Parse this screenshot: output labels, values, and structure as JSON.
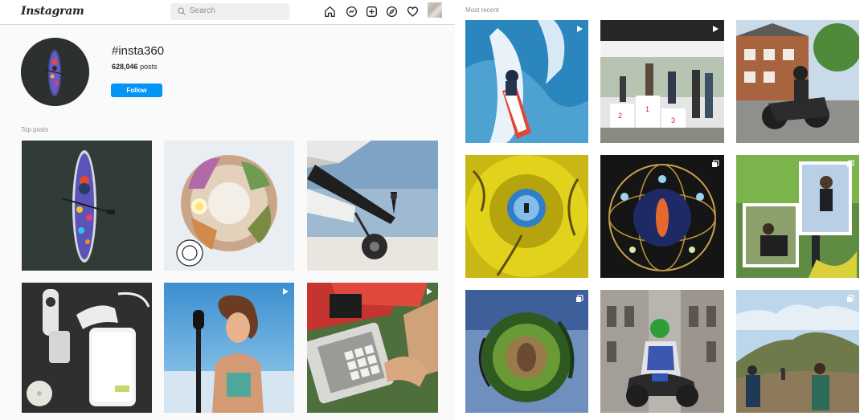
{
  "header": {
    "logo": "Instagram",
    "search_placeholder": "Search",
    "nav_icons": [
      "home-icon",
      "messenger-icon",
      "new-post-icon",
      "explore-icon",
      "activity-heart-icon"
    ]
  },
  "profile": {
    "hashtag": "#insta360",
    "post_count": "628,046",
    "post_label": "posts",
    "follow_label": "Follow"
  },
  "sections": {
    "top_posts_label": "Top posts",
    "most_recent_label": "Most recent"
  },
  "colors": {
    "accent": "#0095f6",
    "panel_bg": "#fafafa",
    "muted_text": "#8e8e8e"
  },
  "top_posts": [
    {
      "subject": "kayak-overhead",
      "video": false
    },
    {
      "subject": "tiny-planet-town",
      "video": false
    },
    {
      "subject": "airplane-wheel",
      "video": false
    },
    {
      "subject": "camera-gear",
      "video": false
    },
    {
      "subject": "woman-selfie-stick",
      "video": true
    },
    {
      "subject": "music-pad",
      "video": true
    }
  ],
  "recent_posts": [
    {
      "subject": "jetski-wake",
      "video": true
    },
    {
      "subject": "podium-ceremony",
      "video": true
    },
    {
      "subject": "motorcycle-street",
      "video": false
    },
    {
      "subject": "yellow-tree-canopy",
      "video": false
    },
    {
      "subject": "night-orb-sculpture",
      "video": false,
      "multi": true
    },
    {
      "subject": "scooter-collage",
      "video": false,
      "multi": true
    },
    {
      "subject": "tiny-planet-forest",
      "video": false,
      "multi": true
    },
    {
      "subject": "sport-bike-rider",
      "video": false
    },
    {
      "subject": "hikers-hill",
      "video": false,
      "multi": true
    }
  ]
}
